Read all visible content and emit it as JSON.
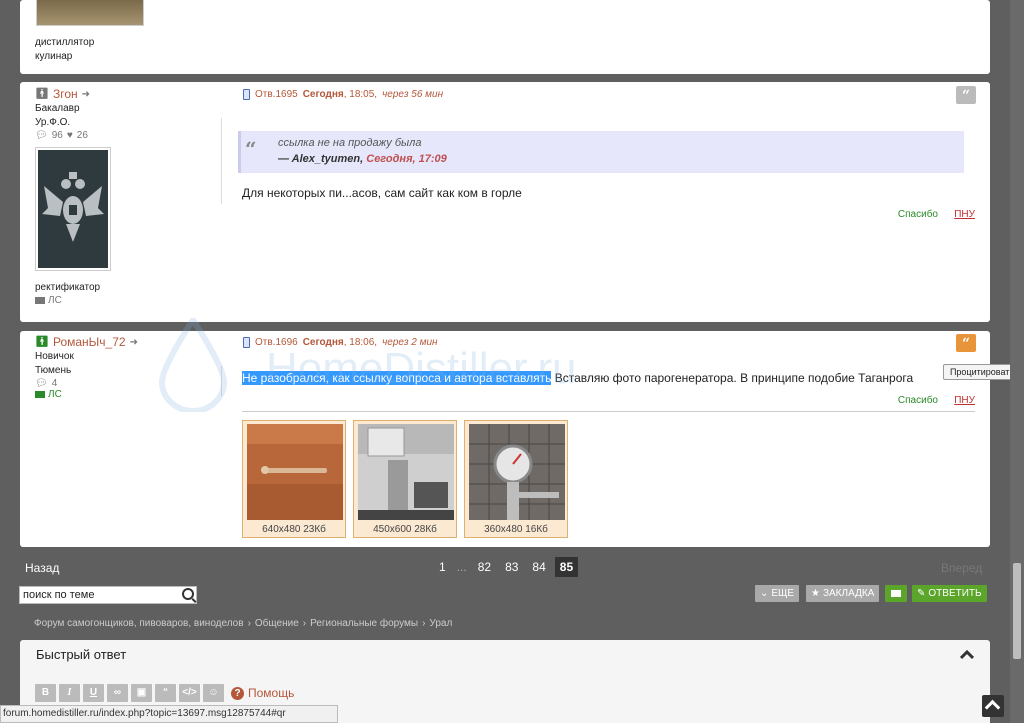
{
  "top_post": {
    "rank": "дистиллятор",
    "role": "кулинар"
  },
  "post1": {
    "username": "Згон",
    "rank": "Бакалавр",
    "location": "Ур.Ф.О.",
    "posts_count": "96",
    "likes_count": "26",
    "role": "ректификатор",
    "pm": "ЛС",
    "reply_num": "Отв.1695",
    "date": "Сегодня",
    "time": ", 18:05,",
    "relative": "через 56 мин",
    "quote_text": "ссылка не на продажу была",
    "quote_author_prefix": "— Alex_tyumen,",
    "quote_author_date": "Сегодня, 17:09",
    "body": "Для некоторых пи...асов, сам сайт как ком в горле",
    "thanks": "Спасибо",
    "pnu": "ПНУ"
  },
  "post2": {
    "username": "РоманЫч_72",
    "rank": "Новичок",
    "location": "Тюмень",
    "posts_count": "4",
    "pm": "ЛС",
    "reply_num": "Отв.1696",
    "date": "Сегодня",
    "time": ", 18:06,",
    "relative": "через 2 мин",
    "body_selected": "Не разобрался, как ссылку вопроса и автора вставлять",
    "body_rest": " Вставляю фото парогенератора. В принципе подобие  Таганрога",
    "thanks": "Спасибо",
    "pnu": "ПНУ",
    "attachments": [
      {
        "caption": "640x480 23Кб"
      },
      {
        "caption": "450x600 28Кб"
      },
      {
        "caption": "360x480 16Кб"
      }
    ]
  },
  "tooltip": "Процитировать",
  "watermark": "HomeDistiller.ru",
  "pagination": {
    "back": "Назад",
    "forward": "Вперед",
    "pages": [
      "1",
      "...",
      "82",
      "83",
      "84",
      "85"
    ],
    "current": "85"
  },
  "search": {
    "placeholder": "поиск по теме",
    "value": "поиск по теме"
  },
  "actions": {
    "more": "ЕЩЕ",
    "bookmark": "ЗАКЛАДКА",
    "reply": "ОТВЕТИТЬ"
  },
  "breadcrumb": [
    "Форум самогонщиков, пивоваров, виноделов",
    "Общение",
    "Региональные форумы",
    "Урал"
  ],
  "quick_reply": {
    "title": "Быстрый ответ",
    "help": "Помощь",
    "toolbar": [
      "B",
      "I",
      "U",
      "link",
      "image",
      "quote",
      "code",
      "smiley"
    ]
  },
  "statusbar": "forum.homedistiller.ru/index.php?topic=13697.msg12875744#qr",
  "colors": {
    "accent": "#b5573a",
    "green": "#2a8a2a",
    "quote_bg": "#e6e7fb",
    "page_bg": "#5f5f5f"
  }
}
